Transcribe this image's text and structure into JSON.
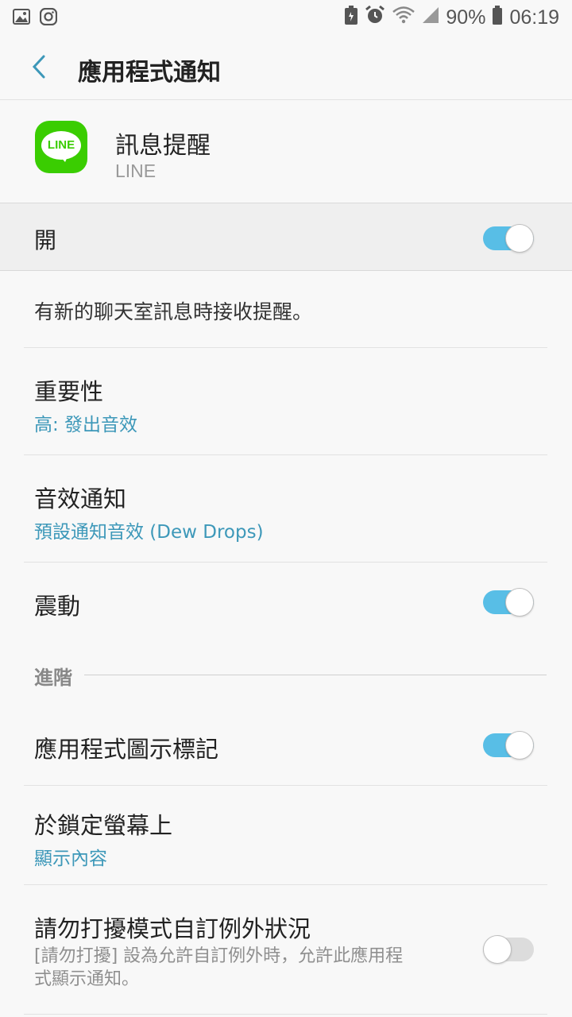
{
  "status_bar": {
    "left_icons": [
      "gallery-icon",
      "instagram-icon"
    ],
    "right_icons": [
      "battery-saver-icon",
      "alarm-icon",
      "wifi-icon",
      "signal-icon",
      "battery-icon"
    ],
    "battery_percent": "90%",
    "time": "06:19"
  },
  "app_bar": {
    "title": "應用程式通知"
  },
  "app_header": {
    "icon_text": "LINE",
    "channel_name": "訊息提醒",
    "app_name": "LINE"
  },
  "master_toggle": {
    "label": "開",
    "state": "on"
  },
  "description": "有新的聊天室訊息時接收提醒。",
  "importance": {
    "title": "重要性",
    "value": "高: 發出音效"
  },
  "sound": {
    "title": "音效通知",
    "value": "預設通知音效 (Dew Drops)"
  },
  "vibration": {
    "title": "震動",
    "state": "on"
  },
  "advanced_section": {
    "label": "進階"
  },
  "badge": {
    "title": "應用程式圖示標記",
    "state": "on"
  },
  "lock_screen": {
    "title": "於鎖定螢幕上",
    "value": "顯示內容"
  },
  "dnd": {
    "title": "請勿打擾模式自訂例外狀況",
    "description": "[請勿打擾] 設為允許自訂例外時，允許此應用程式顯示通知。",
    "state": "off"
  },
  "colors": {
    "accent": "#3d98b9",
    "toggle_on": "#58bee6",
    "toggle_off": "#dcdcdc",
    "line_green": "#3acd01"
  }
}
